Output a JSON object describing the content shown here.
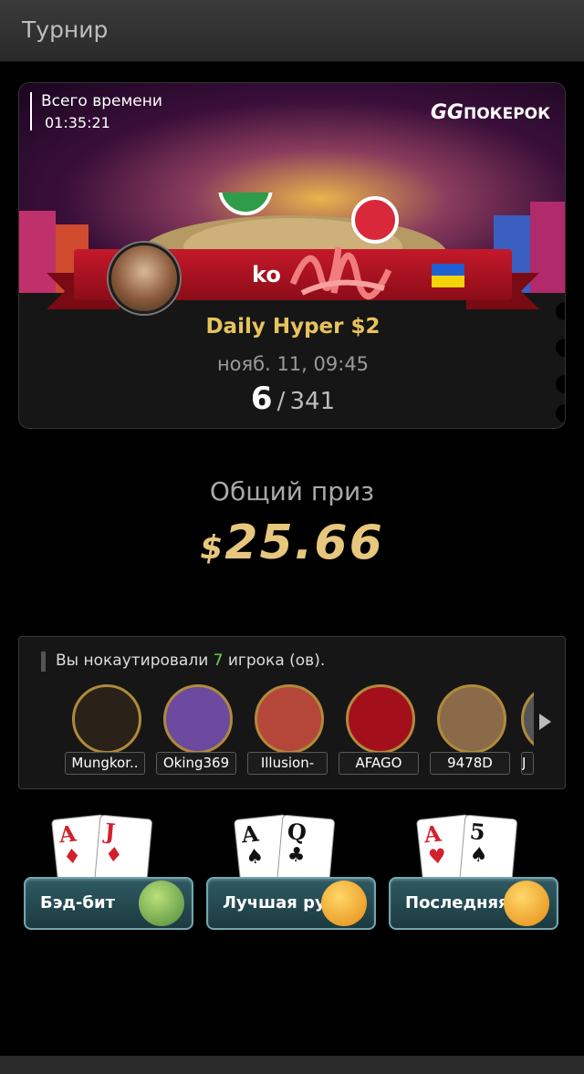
{
  "header": {
    "title": "Турнир"
  },
  "result": {
    "total_time_label": "Всего времени",
    "total_time_value": "01:35:21",
    "brand_gg": "GG",
    "brand_text": "ПОКЕРОК",
    "player_name": "ko",
    "tournament_name": "Daily Hyper $2",
    "date": "нояб. 11, 09:45",
    "place": "6",
    "place_sep": "/",
    "entrants": "341"
  },
  "prize": {
    "label": "Общий приз",
    "currency": "$",
    "amount": "25.66"
  },
  "knockouts": {
    "text_before": "Вы нокаутировали ",
    "count": "7",
    "text_after": " игрока (ов).",
    "players": [
      {
        "name": "Mungkor..",
        "color": "#2a2218"
      },
      {
        "name": "Oking369",
        "color": "#6b4aa0"
      },
      {
        "name": "Illusion-",
        "color": "#b5463a"
      },
      {
        "name": "AFAGO",
        "color": "#a3101b"
      },
      {
        "name": "9478D",
        "color": "#8a6a48"
      },
      {
        "name": "J",
        "color": "#555555"
      }
    ]
  },
  "hands": [
    {
      "label": "Бэд-бит",
      "card1_rank": "A",
      "card1_suit": "♦",
      "card2_rank": "J",
      "card2_suit": "♦",
      "emoji": "crying-face-icon"
    },
    {
      "label": "Лучшая ру",
      "card1_rank": "A",
      "card1_suit": "♠",
      "card2_rank": "Q",
      "card2_suit": "♣",
      "emoji": "thinking-face-icon"
    },
    {
      "label": "Последняя",
      "card1_rank": "A",
      "card1_suit": "♥",
      "card2_rank": "5",
      "card2_suit": "♠",
      "emoji": "facepalm-face-icon"
    }
  ]
}
